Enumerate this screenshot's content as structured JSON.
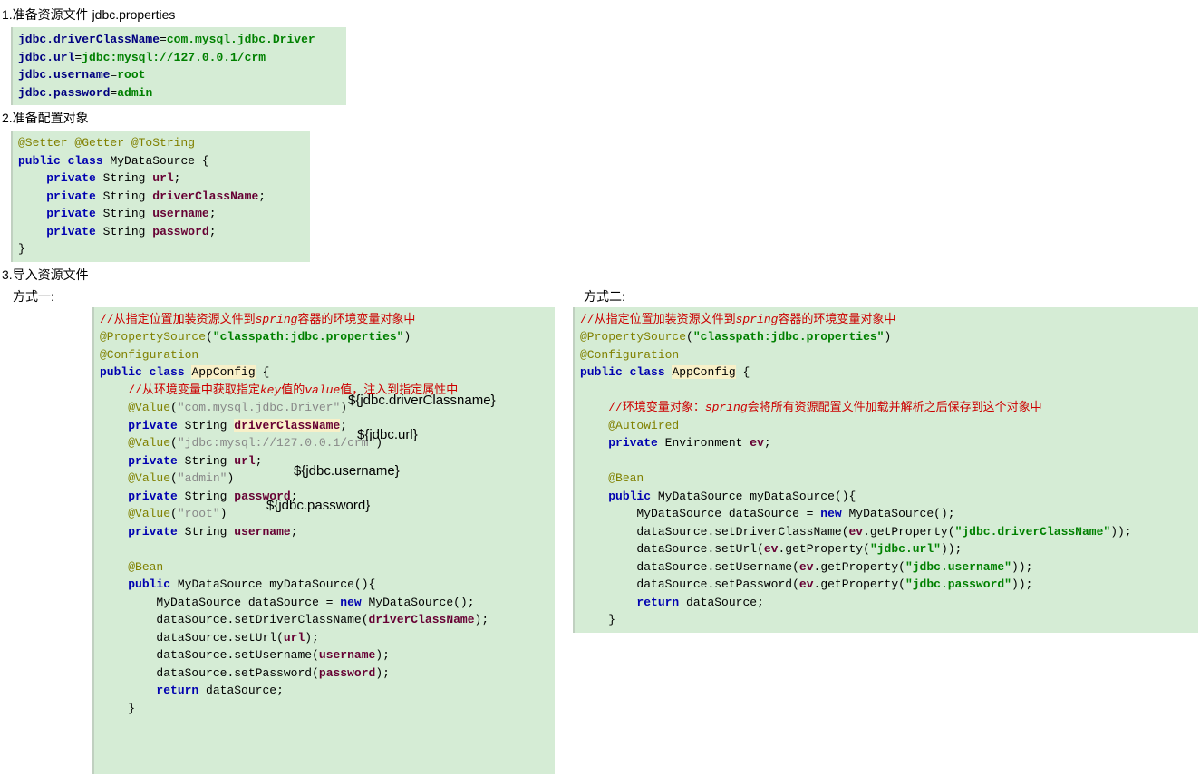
{
  "section1": {
    "title": "1.准备资源文件 jdbc.properties",
    "props": {
      "driverKey": "jdbc.driverClassName",
      "driverVal": "com.mysql.jdbc.Driver",
      "urlKey": "jdbc.url",
      "urlVal": "jdbc:mysql://127.0.0.1/crm",
      "userKey": "jdbc.username",
      "userVal": "root",
      "pwdKey": "jdbc.password",
      "pwdVal": "admin"
    }
  },
  "section2": {
    "title": "2.准备配置对象",
    "annotations": "@Setter @Getter @ToString",
    "kw_public": "public",
    "kw_class": "class",
    "className": "MyDataSource",
    "kw_private": "private",
    "type_string": "String",
    "f_url": "url",
    "f_driver": "driverClassName",
    "f_user": "username",
    "f_pwd": "password"
  },
  "section3": {
    "title": "3.导入资源文件",
    "way1": "方式一:",
    "way2": "方式二:"
  },
  "code3a": {
    "comment1_a": "//从指定位置加装资源文件到",
    "comment1_b": "spring",
    "comment1_c": "容器的环境变量对象中",
    "ps_annot": "@PropertySource",
    "ps_val": "\"classpath:jdbc.properties\"",
    "cfg": "@Configuration",
    "kw_public": "public",
    "kw_class": "class",
    "className": "AppConfig",
    "comment2_a": "//从环境变量中获取指定",
    "comment2_b": "key",
    "comment2_c": "值的",
    "comment2_d": "value",
    "comment2_e": "值，注入到指定属性中",
    "value_annot": "@Value",
    "v1": "\"com.mysql.jdbc.Driver\"",
    "kw_private": "private",
    "type_string": "String",
    "f_driver": "driverClassName",
    "v2": "\"jdbc:mysql://127.0.0.1/crm\"",
    "f_url": "url",
    "v3": "\"admin\"",
    "f_pwd": "password",
    "v4": "\"root\"",
    "f_user": "username",
    "bean": "@Bean",
    "ret_type": "MyDataSource",
    "method": "myDataSource",
    "var": "dataSource",
    "kw_new": "new",
    "kw_return": "return",
    "m_setDriver": "setDriverClassName",
    "m_setUrl": "setUrl",
    "m_setUser": "setUsername",
    "m_setPwd": "setPassword",
    "overlay1": "${jdbc.driverClassname}",
    "overlay2": "${jdbc.url}",
    "overlay3": "${jdbc.username}",
    "overlay4": "${jdbc.password}"
  },
  "code3b": {
    "comment1_a": "//从指定位置加装资源文件到",
    "comment1_b": "spring",
    "comment1_c": "容器的环境变量对象中",
    "ps_annot": "@PropertySource",
    "ps_val": "\"classpath:jdbc.properties\"",
    "cfg": "@Configuration",
    "kw_public": "public",
    "kw_class": "class",
    "className": "AppConfig",
    "comment2_a": "//环境变量对象：",
    "comment2_b": "spring",
    "comment2_c": "会将所有资源配置文件加载并解析之后保存到这个对象中",
    "autowired": "@Autowired",
    "kw_private": "private",
    "env_type": "Environment",
    "env_var": "ev",
    "bean": "@Bean",
    "ret_type": "MyDataSource",
    "method": "myDataSource",
    "var": "dataSource",
    "kw_new": "new",
    "kw_return": "return",
    "m_setDriver": "setDriverClassName",
    "m_setUrl": "setUrl",
    "m_setUser": "setUsername",
    "m_setPwd": "setPassword",
    "m_getProp": "getProperty",
    "p1": "\"jdbc.driverClassName\"",
    "p2": "\"jdbc.url\"",
    "p3": "\"jdbc.username\"",
    "p4": "\"jdbc.password\""
  }
}
